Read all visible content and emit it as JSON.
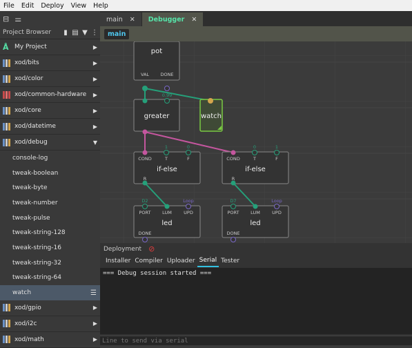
{
  "menubar": [
    "File",
    "Edit",
    "Deploy",
    "View",
    "Help"
  ],
  "sidebar": {
    "title": "Project Browser",
    "libraries": [
      {
        "label": "My Project",
        "icon": "project-icon",
        "arrow": "▶"
      },
      {
        "label": "xod/bits",
        "icon": "library-icon",
        "arrow": "▶"
      },
      {
        "label": "xod/color",
        "icon": "library-icon",
        "arrow": "▶"
      },
      {
        "label": "xod/common-hardware",
        "icon": "library-icon",
        "arrow": "▶"
      },
      {
        "label": "xod/core",
        "icon": "library-icon",
        "arrow": "▶"
      },
      {
        "label": "xod/datetime",
        "icon": "library-icon",
        "arrow": "▶"
      },
      {
        "label": "xod/debug",
        "icon": "library-icon",
        "arrow": "▼"
      }
    ],
    "debug_nodes": [
      "console-log",
      "tweak-boolean",
      "tweak-byte",
      "tweak-number",
      "tweak-pulse",
      "tweak-string-128",
      "tweak-string-16",
      "tweak-string-32",
      "tweak-string-64",
      "watch"
    ],
    "after": [
      {
        "label": "xod/gpio",
        "icon": "library-icon",
        "arrow": "▶"
      },
      {
        "label": "xod/i2c",
        "icon": "library-icon",
        "arrow": "▶"
      },
      {
        "label": "xod/math",
        "icon": "library-icon",
        "arrow": "▶"
      }
    ]
  },
  "tabs": [
    {
      "label": "main",
      "close": "✕"
    },
    {
      "label": "Debugger",
      "close": "✕"
    }
  ],
  "breadcrumb": "main",
  "graph": {
    "pot": {
      "title": "pot",
      "pins": [
        "VAL",
        "DONE"
      ]
    },
    "greater": {
      "title": "greater",
      "value": "0.99"
    },
    "watch": {
      "title": "watch"
    },
    "ifelse1": {
      "title": "if-else",
      "pins": [
        "COND",
        "T",
        "F"
      ],
      "values": [
        "1",
        "0"
      ],
      "out": "R"
    },
    "ifelse2": {
      "title": "if-else",
      "pins": [
        "COND",
        "T",
        "F"
      ],
      "values": [
        "0",
        "1"
      ],
      "out": "R"
    },
    "led1": {
      "title": "led",
      "pins": [
        "PORT",
        "LUM",
        "UPD"
      ],
      "port": "D2",
      "upd": "Loop",
      "done": "DONE"
    },
    "led2": {
      "title": "led",
      "pins": [
        "PORT",
        "LUM",
        "UPD"
      ],
      "port": "D7",
      "upd": "Loop",
      "done": "DONE"
    }
  },
  "deployment": {
    "title": "Deployment",
    "tabs": [
      "Installer",
      "Compiler",
      "Uploader",
      "Serial",
      "Tester"
    ],
    "active_tab": "Serial",
    "log": "=== Debug session started ===",
    "input_placeholder": "Line to send via serial"
  },
  "colors": {
    "pulse": "#c4569e",
    "number": "#25a07a",
    "boolean": "#d0608a",
    "watch": "#7ac943",
    "accent": "#56e3a8",
    "link": "#4fc8f0"
  }
}
